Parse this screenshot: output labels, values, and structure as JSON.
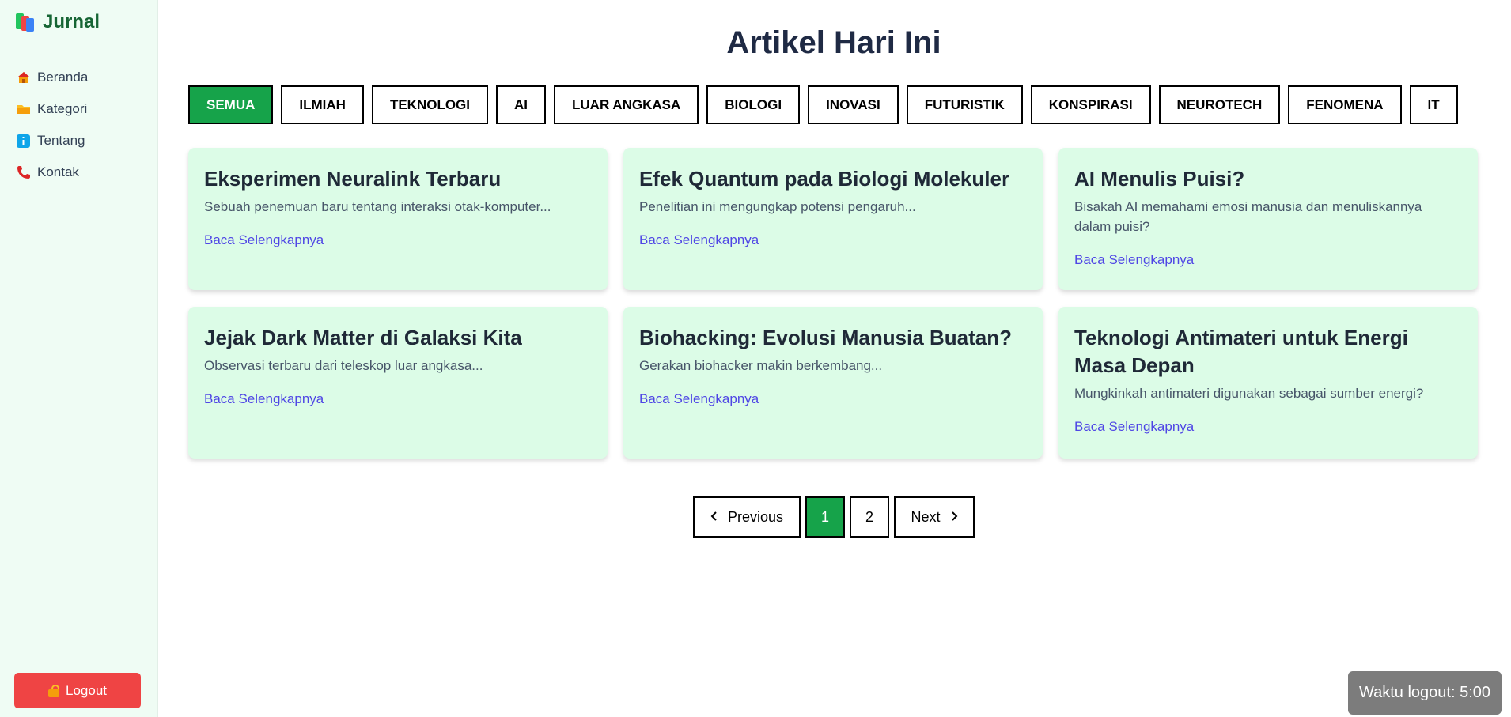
{
  "sidebar": {
    "brand": "Jurnal",
    "items": [
      {
        "label": "Beranda",
        "icon": "home-icon"
      },
      {
        "label": "Kategori",
        "icon": "folder-icon"
      },
      {
        "label": "Tentang",
        "icon": "info-icon"
      },
      {
        "label": "Kontak",
        "icon": "phone-icon"
      }
    ],
    "logout_label": "Logout"
  },
  "main": {
    "title": "Artikel Hari Ini",
    "categories": [
      "SEMUA",
      "ILMIAH",
      "TEKNOLOGI",
      "AI",
      "LUAR ANGKASA",
      "BIOLOGI",
      "INOVASI",
      "FUTURISTIK",
      "KONSPIRASI",
      "NEUROTECH",
      "FENOMENA",
      "IT"
    ],
    "active_category": "SEMUA",
    "articles": [
      {
        "title": "Eksperimen Neuralink Terbaru",
        "excerpt": "Sebuah penemuan baru tentang interaksi otak-komputer...",
        "link": "Baca Selengkapnya"
      },
      {
        "title": "Efek Quantum pada Biologi Molekuler",
        "excerpt": "Penelitian ini mengungkap potensi pengaruh...",
        "link": "Baca Selengkapnya"
      },
      {
        "title": "AI Menulis Puisi?",
        "excerpt": "Bisakah AI memahami emosi manusia dan menuliskannya dalam puisi?",
        "link": "Baca Selengkapnya"
      },
      {
        "title": "Jejak Dark Matter di Galaksi Kita",
        "excerpt": "Observasi terbaru dari teleskop luar angkasa...",
        "link": "Baca Selengkapnya"
      },
      {
        "title": "Biohacking: Evolusi Manusia Buatan?",
        "excerpt": "Gerakan biohacker makin berkembang...",
        "link": "Baca Selengkapnya"
      },
      {
        "title": "Teknologi Antimateri untuk Energi Masa Depan",
        "excerpt": "Mungkinkah antimateri digunakan sebagai sumber energi?",
        "link": "Baca Selengkapnya"
      }
    ]
  },
  "pagination": {
    "previous_label": "Previous",
    "pages": [
      "1",
      "2"
    ],
    "current_page": "1",
    "next_label": "Next"
  },
  "timer": {
    "text": "Waktu logout: 5:00"
  },
  "colors": {
    "accent": "#16a34a",
    "sidebar_bg": "#effcf4",
    "card_bg": "#dcfce7",
    "logout_bg": "#ef4444",
    "link": "#4f46e5"
  }
}
